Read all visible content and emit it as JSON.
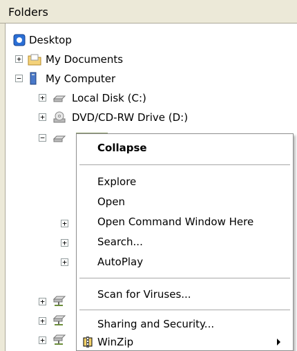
{
  "pane": {
    "title": "Folders"
  },
  "tree": {
    "desktop": "Desktop",
    "my_documents": "My Documents",
    "my_computer": "My Computer",
    "local_disk": "Local Disk (C:)",
    "dvd_drive": "DVD/CD-RW Drive (D:)"
  },
  "context_menu": {
    "items": [
      {
        "label": "Collapse",
        "bold": true
      },
      {
        "label": "Explore"
      },
      {
        "label": "Open"
      },
      {
        "label": "Open Command Window Here"
      },
      {
        "label": "Search..."
      },
      {
        "label": "AutoPlay"
      },
      {
        "label": "Scan for Viruses..."
      },
      {
        "label": "Sharing and Security..."
      },
      {
        "label": "WinZip",
        "has_submenu": true
      }
    ]
  },
  "colors": {
    "selection": "#8a9a6b",
    "header_bg": "#ece9d8"
  }
}
